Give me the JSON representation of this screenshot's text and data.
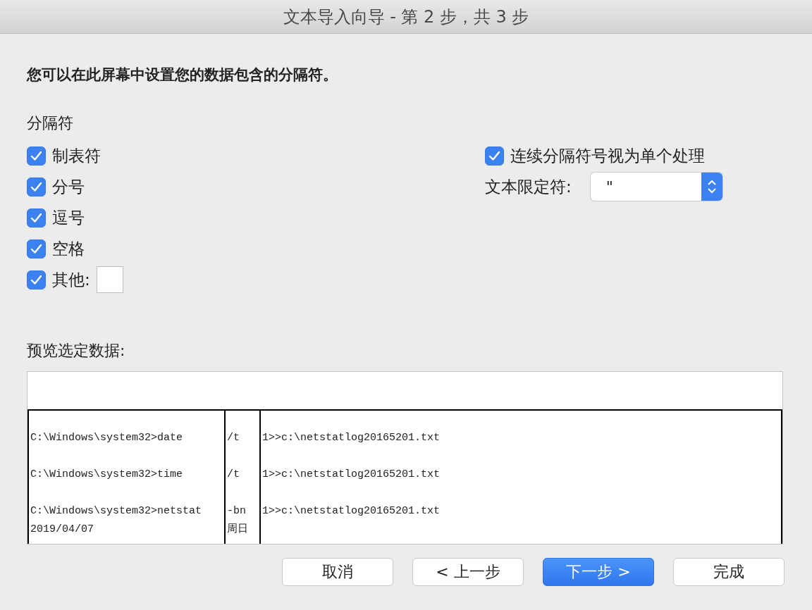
{
  "window": {
    "title": "文本导入向导 - 第 2 步，共 3 步"
  },
  "instruction": "您可以在此屏幕中设置您的数据包含的分隔符。",
  "delimiters": {
    "label": "分隔符",
    "items": [
      {
        "label": "制表符",
        "checked": true,
        "kind": "plain"
      },
      {
        "label": "分号",
        "checked": true,
        "kind": "plain"
      },
      {
        "label": "逗号",
        "checked": true,
        "kind": "plain"
      },
      {
        "label": "空格",
        "checked": true,
        "kind": "plain"
      },
      {
        "label": "其他:",
        "checked": true,
        "kind": "other"
      }
    ]
  },
  "consecutive": {
    "label": "连续分隔符号视为单个处理",
    "checked": true
  },
  "qualifier": {
    "label": "文本限定符:",
    "value": "\""
  },
  "preview": {
    "label": "预览选定数据:",
    "rows": [
      [
        "C:\\Windows\\system32>date",
        "/t",
        "1>>c:\\netstatlog20165201.txt"
      ],
      [
        "C:\\Windows\\system32>time",
        "/t",
        "1>>c:\\netstatlog20165201.txt"
      ],
      [
        "C:\\Windows\\system32>netstat\n2019/04/07",
        "-bn\n周日",
        "1>>c:\\netstatlog20165201.txt"
      ]
    ]
  },
  "buttons": [
    {
      "label": "取消",
      "selected": false
    },
    {
      "label": "< 上一步",
      "selected": false
    },
    {
      "label": "下一步 >",
      "selected": true
    },
    {
      "label": "完成",
      "selected": false
    }
  ]
}
